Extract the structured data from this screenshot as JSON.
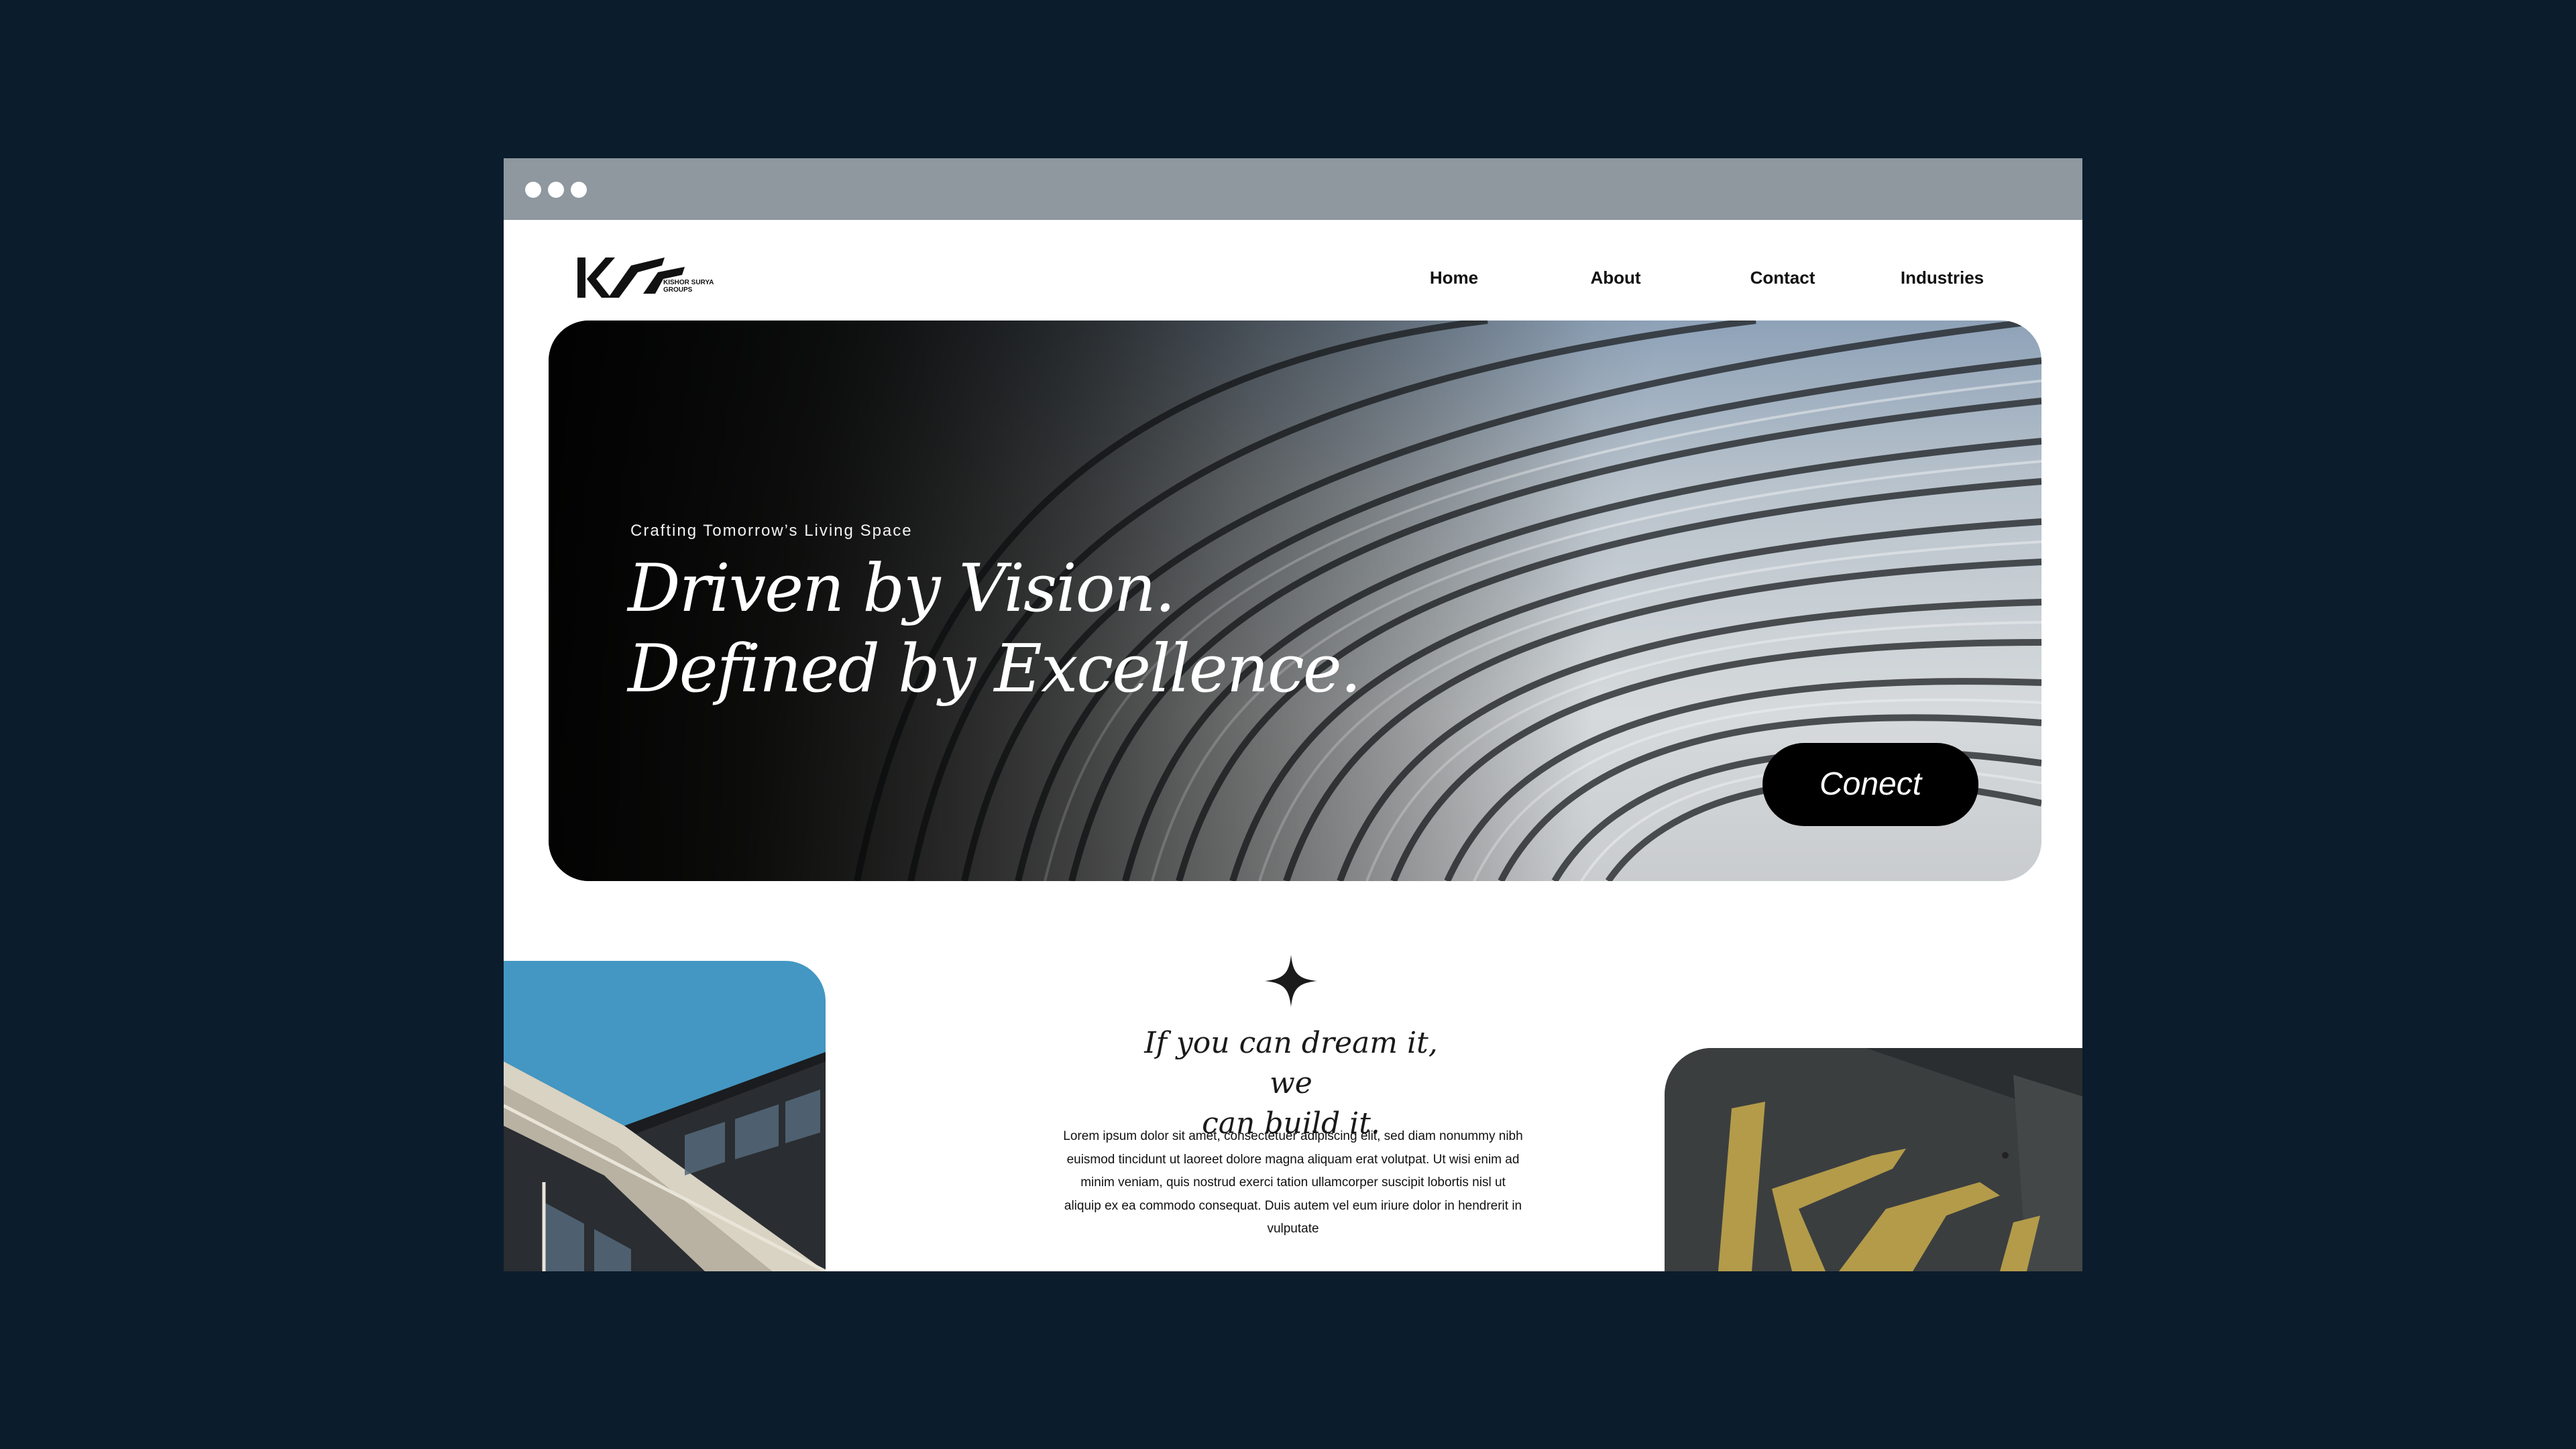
{
  "brand": {
    "logo_alt": "KS",
    "logo_subtitle": "KISHOR SURYA GROUPS"
  },
  "nav": {
    "items": [
      {
        "label": "Home"
      },
      {
        "label": "About"
      },
      {
        "label": "Contact"
      },
      {
        "label": "Industries"
      }
    ]
  },
  "hero": {
    "eyebrow": "Crafting Tomorrow’s Living Space",
    "title_line1": "Driven by Vision.",
    "title_line2": "Defined by Excellence.",
    "cta_label": "Conect"
  },
  "section": {
    "tagline_line1": "If you can dream it, we",
    "tagline_line2": "can build it.",
    "body": "Lorem ipsum dolor sit amet, consectetuer adipiscing elit, sed diam nonummy nibh euismod tincidunt ut laoreet dolore magna aliquam erat volutpat. Ut wisi enim ad minim veniam, quis nostrud exerci tation ullamcorper suscipit lobortis nisl ut aliquip ex ea commodo consequat. Duis autem vel eum iriure dolor in hendrerit in vulputate"
  },
  "colors": {
    "page_background": "#0b1c2c",
    "titlebar": "#8f979f",
    "sky": "#3f93bf",
    "gold": "#b39b4a",
    "button": "#000000"
  },
  "icons": [
    "window-dot-icon",
    "four-point-star-icon"
  ]
}
